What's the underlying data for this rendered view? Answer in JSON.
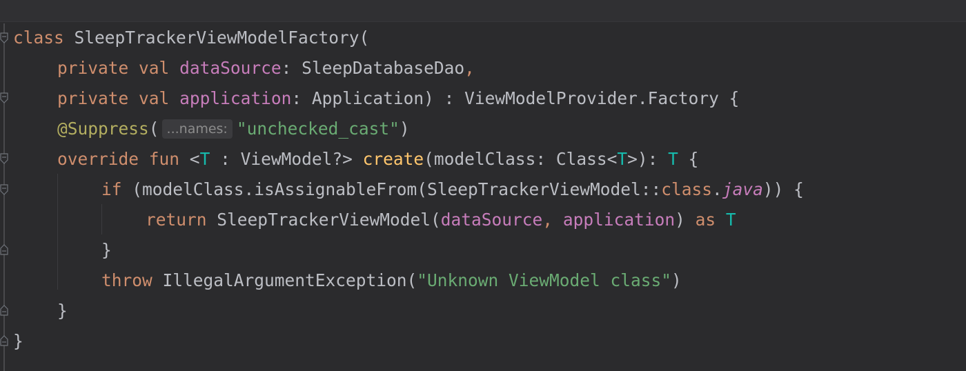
{
  "editor": {
    "language": "kotlin",
    "colors": {
      "background": "#2b2b2d",
      "keyword": "#cf8e6d",
      "property": "#c77dbb",
      "string": "#6aab73",
      "annotation": "#b3ae60",
      "function": "#ffc66d",
      "type_param": "#16baac",
      "default": "#bcbec4"
    },
    "lines": [
      {
        "tokens": [
          {
            "t": "class",
            "c": "kw"
          },
          {
            "t": " SleepTrackerViewModelFactory(",
            "c": ""
          }
        ]
      },
      {
        "tokens": [
          {
            "t": "private",
            "c": "kw"
          },
          {
            "t": " ",
            "c": ""
          },
          {
            "t": "val",
            "c": "kw"
          },
          {
            "t": " ",
            "c": ""
          },
          {
            "t": "dataSource",
            "c": "prop"
          },
          {
            "t": ": SleepDatabaseDao",
            "c": ""
          },
          {
            "t": ",",
            "c": "kw"
          }
        ]
      },
      {
        "tokens": [
          {
            "t": "private",
            "c": "kw"
          },
          {
            "t": " ",
            "c": ""
          },
          {
            "t": "val",
            "c": "kw"
          },
          {
            "t": " ",
            "c": ""
          },
          {
            "t": "application",
            "c": "prop"
          },
          {
            "t": ": Application) : ViewModelProvider.Factory {",
            "c": ""
          }
        ]
      },
      {
        "tokens": [
          {
            "t": "@Suppress",
            "c": "ann"
          },
          {
            "t": "(",
            "c": ""
          },
          {
            "t": "...names:",
            "c": "hint"
          },
          {
            "t": "\"unchecked_cast\"",
            "c": "str"
          },
          {
            "t": ")",
            "c": ""
          }
        ]
      },
      {
        "tokens": [
          {
            "t": "override",
            "c": "kw"
          },
          {
            "t": " ",
            "c": ""
          },
          {
            "t": "fun",
            "c": "kw"
          },
          {
            "t": " <",
            "c": ""
          },
          {
            "t": "T",
            "c": "tp"
          },
          {
            "t": " : ViewModel?> ",
            "c": ""
          },
          {
            "t": "create",
            "c": "fn"
          },
          {
            "t": "(modelClass: Class<",
            "c": ""
          },
          {
            "t": "T",
            "c": "tp"
          },
          {
            "t": ">): ",
            "c": ""
          },
          {
            "t": "T",
            "c": "tp"
          },
          {
            "t": " {",
            "c": ""
          }
        ]
      },
      {
        "tokens": [
          {
            "t": "if",
            "c": "kw"
          },
          {
            "t": " (modelClass.isAssignableFrom(SleepTrackerViewModel::",
            "c": ""
          },
          {
            "t": "class",
            "c": "kw"
          },
          {
            "t": ".",
            "c": ""
          },
          {
            "t": "java",
            "c": "it"
          },
          {
            "t": ")) {",
            "c": ""
          }
        ]
      },
      {
        "tokens": [
          {
            "t": "return",
            "c": "kw"
          },
          {
            "t": " SleepTrackerViewModel(",
            "c": ""
          },
          {
            "t": "dataSource",
            "c": "prop"
          },
          {
            "t": ", ",
            "c": "kw"
          },
          {
            "t": "application",
            "c": "prop"
          },
          {
            "t": ") ",
            "c": ""
          },
          {
            "t": "as",
            "c": "kw"
          },
          {
            "t": " ",
            "c": ""
          },
          {
            "t": "T",
            "c": "tp"
          }
        ]
      },
      {
        "tokens": [
          {
            "t": "}",
            "c": ""
          }
        ]
      },
      {
        "tokens": [
          {
            "t": "throw",
            "c": "kw"
          },
          {
            "t": " IllegalArgumentException(",
            "c": ""
          },
          {
            "t": "\"Unknown ViewModel class\"",
            "c": "str"
          },
          {
            "t": ")",
            "c": ""
          }
        ]
      },
      {
        "tokens": [
          {
            "t": "}",
            "c": ""
          }
        ]
      },
      {
        "tokens": [
          {
            "t": "}",
            "c": ""
          }
        ]
      }
    ]
  }
}
